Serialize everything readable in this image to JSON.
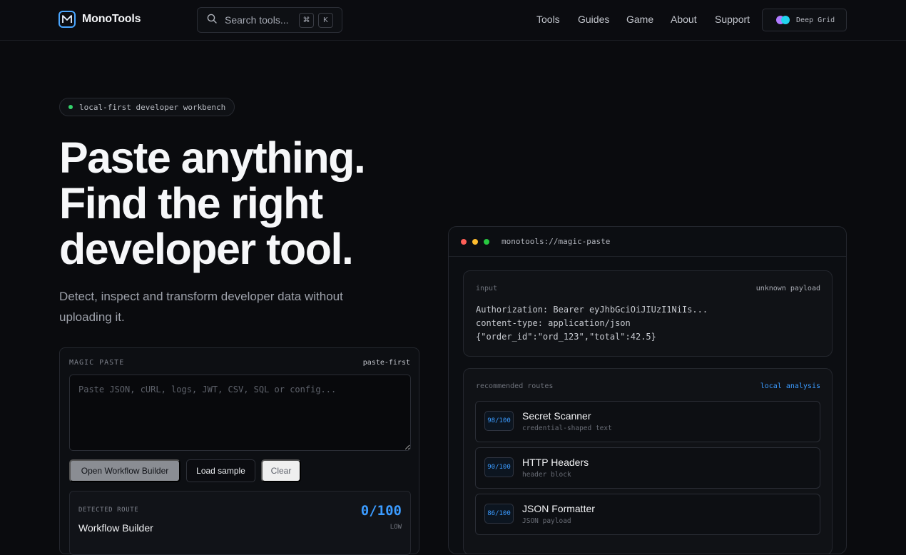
{
  "header": {
    "brand": "MonoTools",
    "search": {
      "label": "Search tools...",
      "key1": "⌘",
      "key2": "K"
    },
    "nav": [
      "Tools",
      "Guides",
      "Game",
      "About",
      "Support"
    ],
    "theme": {
      "label": "Deep Grid",
      "colors": [
        "#b07cff",
        "#22d3ee"
      ]
    }
  },
  "hero": {
    "badge": "local-first developer workbench",
    "headline_lines": [
      "Paste anything.",
      "Find the right",
      "developer tool."
    ],
    "subtext": "Detect, inspect and transform developer data without uploading it."
  },
  "magic_paste": {
    "title": "MAGIC PASTE",
    "tag": "paste-first",
    "placeholder": "Paste JSON, cURL, logs, JWT, CSV, SQL or config...",
    "buttons": {
      "primary": "Open Workflow Builder",
      "secondary": "Load sample",
      "ghost": "Clear"
    },
    "detected": {
      "label": "DETECTED ROUTE",
      "name": "Workflow Builder",
      "score": "0/100",
      "level": "LOW"
    }
  },
  "preview_card": {
    "url": "monotools://magic-paste",
    "input": {
      "label": "input",
      "tag": "unknown payload",
      "lines": [
        "Authorization: Bearer eyJhbGciOiJIUzI1NiIs...",
        "content-type: application/json",
        "{\"order_id\":\"ord_123\",\"total\":42.5}"
      ]
    },
    "recommended": {
      "label": "recommended routes",
      "tag": "local analysis",
      "items": [
        {
          "score": "98/100",
          "title": "Secret Scanner",
          "sub": "credential-shaped text"
        },
        {
          "score": "90/100",
          "title": "HTTP Headers",
          "sub": "header block"
        },
        {
          "score": "86/100",
          "title": "JSON Formatter",
          "sub": "JSON payload"
        }
      ]
    }
  },
  "colors": {
    "accent": "#3b9bff",
    "status_green": "#34d36b",
    "background": "#0a0b0e"
  }
}
